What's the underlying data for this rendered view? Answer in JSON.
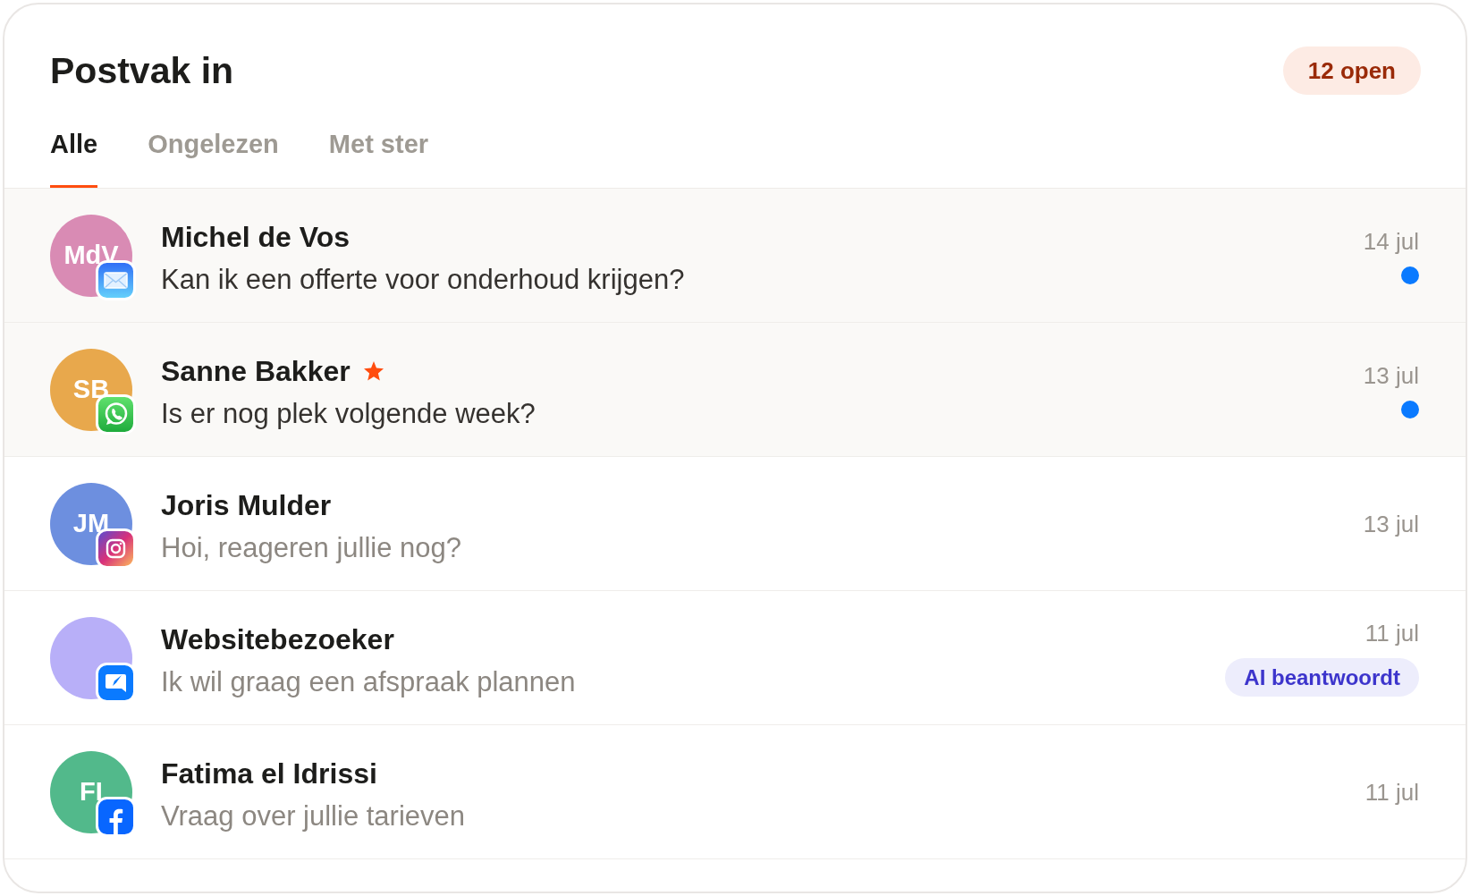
{
  "header": {
    "title": "Postvak in",
    "badge": "12 open"
  },
  "tabs": [
    {
      "label": "Alle",
      "selected": true
    },
    {
      "label": "Ongelezen",
      "selected": false
    },
    {
      "label": "Met ster",
      "selected": false
    }
  ],
  "conversations": [
    {
      "name": "Michel de Vos",
      "initials": "MdV",
      "color": "#d98bb4",
      "kind": "mail",
      "starred": false,
      "preview": "Kan ik een offerte voor onderhoud krijgen?",
      "date": "14 jul",
      "unread": true
    },
    {
      "name": "Sanne Bakker",
      "initials": "SB",
      "color": "#e8a84c",
      "kind": "phone",
      "starred": true,
      "preview": "Is er nog plek volgende week?",
      "date": "13 jul",
      "unread": true
    },
    {
      "name": "Joris Mulder",
      "initials": "JM",
      "color": "#6d8fdf",
      "kind": "camera",
      "starred": false,
      "preview": "Hoi, reageren jullie nog?",
      "date": "13 jul",
      "unread": false
    },
    {
      "name": "Websitebezoeker",
      "color": "#b8aff8",
      "kind": "chat",
      "starred": false,
      "preview": "Ik wil graag een afspraak plannen",
      "date": "11 jul",
      "unread": false,
      "tag": "AI beantwoordt"
    },
    {
      "name": "Fatima el Idrissi",
      "initials": "FI",
      "color": "#52b98b",
      "kind": "social",
      "starred": false,
      "preview": "Vraag over jullie tarieven",
      "date": "11 jul",
      "unread": false
    }
  ]
}
